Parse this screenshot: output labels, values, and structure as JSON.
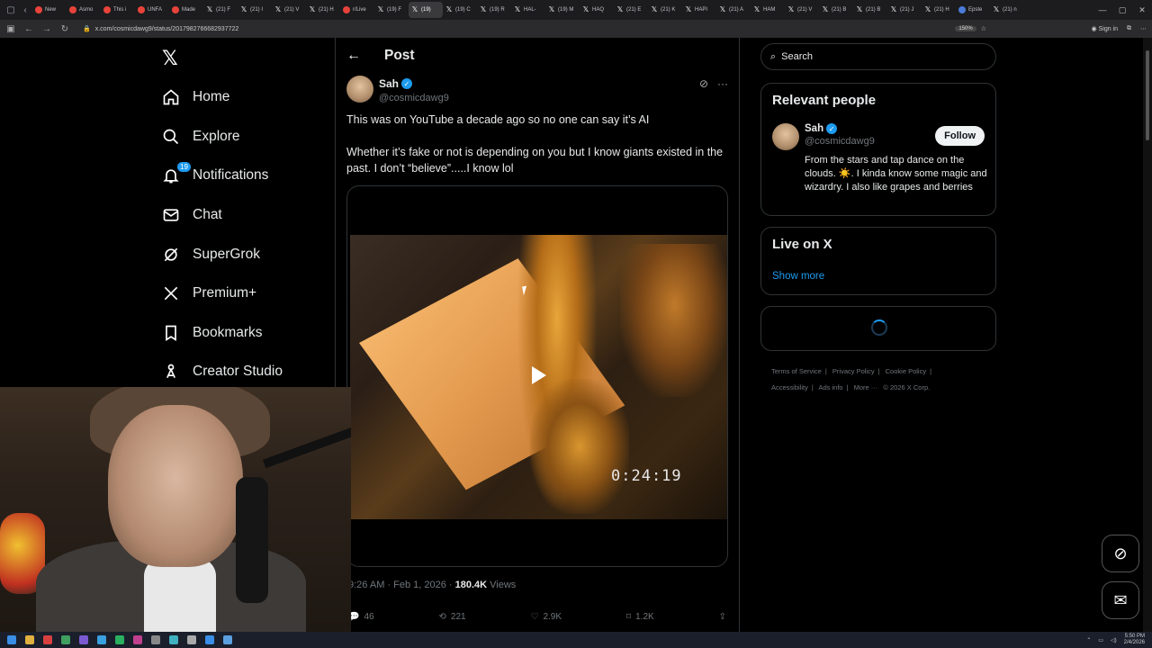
{
  "browser": {
    "tabs": [
      {
        "label": "New",
        "icon": "red"
      },
      {
        "label": "Asmo",
        "icon": "red"
      },
      {
        "label": "This i",
        "icon": "red"
      },
      {
        "label": "UNFA",
        "icon": "red"
      },
      {
        "label": "Made",
        "icon": "red"
      },
      {
        "label": "(21) F",
        "icon": "x"
      },
      {
        "label": "(21) I",
        "icon": "x"
      },
      {
        "label": "(21) V",
        "icon": "x"
      },
      {
        "label": "(21) H",
        "icon": "x"
      },
      {
        "label": "r/Live",
        "icon": "red"
      },
      {
        "label": "(19) F",
        "icon": "x"
      },
      {
        "label": "(19)",
        "icon": "x",
        "active": true
      },
      {
        "label": "(19) C",
        "icon": "x"
      },
      {
        "label": "(19) R",
        "icon": "x"
      },
      {
        "label": "HAL-",
        "icon": "x"
      },
      {
        "label": "(19) M",
        "icon": "x"
      },
      {
        "label": "HAQ",
        "icon": "x"
      },
      {
        "label": "(21) E",
        "icon": "x"
      },
      {
        "label": "(21) K",
        "icon": "x"
      },
      {
        "label": "HAPI",
        "icon": "x"
      },
      {
        "label": "(21) A",
        "icon": "x"
      },
      {
        "label": "HAM",
        "icon": "x"
      },
      {
        "label": "(21) V",
        "icon": "x"
      },
      {
        "label": "(21) B",
        "icon": "x"
      },
      {
        "label": "(21) B",
        "icon": "x"
      },
      {
        "label": "(21) J",
        "icon": "x"
      },
      {
        "label": "(21) H",
        "icon": "x"
      },
      {
        "label": "Epste",
        "icon": "blue"
      },
      {
        "label": "(21) n",
        "icon": "x"
      }
    ],
    "url": "x.com/cosmicdawg9/status/2017982766682937722",
    "zoom": "150%",
    "signin": "Sign in"
  },
  "nav": {
    "logo": "𝕏",
    "notifications_badge": "19",
    "items": [
      {
        "label": "Home",
        "icon": "home-icon"
      },
      {
        "label": "Explore",
        "icon": "search-icon"
      },
      {
        "label": "Notifications",
        "icon": "bell-icon"
      },
      {
        "label": "Chat",
        "icon": "mail-icon"
      },
      {
        "label": "SuperGrok",
        "icon": "grok-icon"
      },
      {
        "label": "Premium+",
        "icon": "x-icon"
      },
      {
        "label": "Bookmarks",
        "icon": "bookmark-icon"
      },
      {
        "label": "Creator Studio",
        "icon": "creator-icon"
      }
    ]
  },
  "post": {
    "header_title": "Post",
    "author_name": "Sah",
    "author_handle": "@cosmicdawg9",
    "text1": "This was on YouTube a decade ago so no one can say it’s AI",
    "text2": "Whether it’s fake or not is depending on you but I know giants existed in the past. I don’t “believe”.....I know lol",
    "video_timecode": "0:24:19",
    "time": "9:26 AM · Feb 1, 2026 · ",
    "views_count": "180.4K",
    "views_label": " Views",
    "replies": "46",
    "reposts": "221",
    "likes": "2.9K",
    "bookmarks": "1.2K"
  },
  "sidebar": {
    "search_placeholder": "Search",
    "relevant_title": "Relevant people",
    "person_name": "Sah",
    "person_handle": "@cosmicdawg9",
    "follow_label": "Follow",
    "person_bio": "From the stars and tap dance on the clouds. ☀️. I kinda know some magic and wizardry. I also like grapes and berries",
    "live_title": "Live on X",
    "show_more": "Show more",
    "footer": [
      "Terms of Service",
      "|",
      "Privacy Policy",
      "|",
      "Cookie Policy",
      "|",
      "Accessibility",
      "|",
      "Ads info",
      "|",
      "More ···",
      "© 2026 X Corp."
    ]
  },
  "taskbar": {
    "time": "5:50 PM",
    "date": "2/4/2026"
  },
  "colors": {
    "accent": "#1d9bf0",
    "background": "#000000",
    "border": "#2f3336",
    "muted": "#71767b"
  }
}
